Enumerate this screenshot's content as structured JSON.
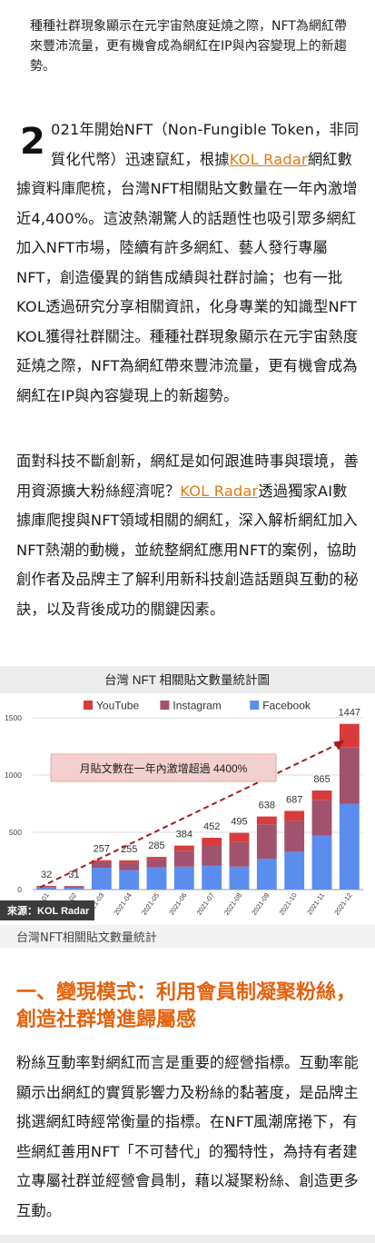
{
  "lead": "種種社群現象顯示在元宇宙熱度延燒之際，NFT為網紅帶來豐沛流量，更有機會成為網紅在IP與內容變現上的新趨勢。",
  "para1": {
    "dropcap": "2",
    "text_a": "021年開始NFT（Non-Fungible Token，非同質化代幣）迅速竄紅，根據",
    "kol": "KOL Radar",
    "text_b": "網紅數據資料庫爬梳，台灣NFT相關貼文數量在一年內激增近4,400%。這波熱潮驚人的話題性也吸引眾多網紅加入NFT市場，陸續有許多網紅、藝人發行專屬NFT，創造優異的銷售成績與社群討論；也有一批KOL透過研究分享相關資訊，化身專業的知識型NFT KOL獲得社群關注。種種社群現象顯示在元宇宙熱度延燒之際，NFT為網紅帶來豐沛流量，更有機會成為網紅在IP與內容變現上的新趨勢。"
  },
  "para2": {
    "text_a": "面對科技不斷創新，網紅是如何跟進時事與環境，善用資源擴大粉絲經濟呢？",
    "kol": "KOL Radar",
    "text_b": "透過獨家AI數據庫爬搜與NFT領域相關的網紅，深入解析網紅加入NFT熱潮的動機，並統整網紅應用NFT的案例，協助創作者及品牌主了解利用新科技創造話題與互動的秘訣，以及背後成功的關鍵因素。"
  },
  "chart_data": {
    "type": "bar",
    "stacked": true,
    "title": "台灣 NFT 相關貼文數量統計圖",
    "categories": [
      "2021-01",
      "2021-02",
      "2021-03",
      "2021-04",
      "2021-05",
      "2021-06",
      "2021-07",
      "2021-08",
      "2021-09",
      "2021-10",
      "2021-11",
      "2021-12"
    ],
    "series": [
      {
        "name": "Facebook",
        "color": "#5b8def",
        "values": [
          18,
          16,
          190,
          170,
          195,
          200,
          210,
          200,
          270,
          330,
          470,
          750
        ]
      },
      {
        "name": "Instagram",
        "color": "#a0526e",
        "values": [
          10,
          10,
          57,
          65,
          70,
          140,
          175,
          215,
          300,
          270,
          310,
          490
        ]
      },
      {
        "name": "YouTube",
        "color": "#d93b3b",
        "values": [
          4,
          5,
          10,
          20,
          20,
          44,
          67,
          80,
          68,
          87,
          85,
          207
        ]
      }
    ],
    "totals": [
      32,
      31,
      257,
      255,
      285,
      384,
      452,
      495,
      638,
      687,
      865,
      1447
    ],
    "ylim": [
      0,
      1500
    ],
    "yticks": [
      0,
      500,
      1000,
      1500
    ],
    "legend": "top",
    "annotation": "月貼文數在一年內激增超過 4400%",
    "source_label": "來源：KOL Radar",
    "grid": true
  },
  "caption": "台灣NFT相關貼文數量統計",
  "heading": "一、變現模式：利用會員制凝聚粉絲，創造社群增進歸屬感",
  "para3": "粉絲互動率對網紅而言是重要的經營指標。互動率能顯示出網紅的實質影響力及粉絲的黏著度，是品牌主挑選網紅時經常衡量的指標。在NFT風潮席捲下，有些網紅善用NFT「不可替代」的獨特性，為持有者建立專屬社群並經營會員制，藉以凝聚粉絲、創造更多互動。"
}
